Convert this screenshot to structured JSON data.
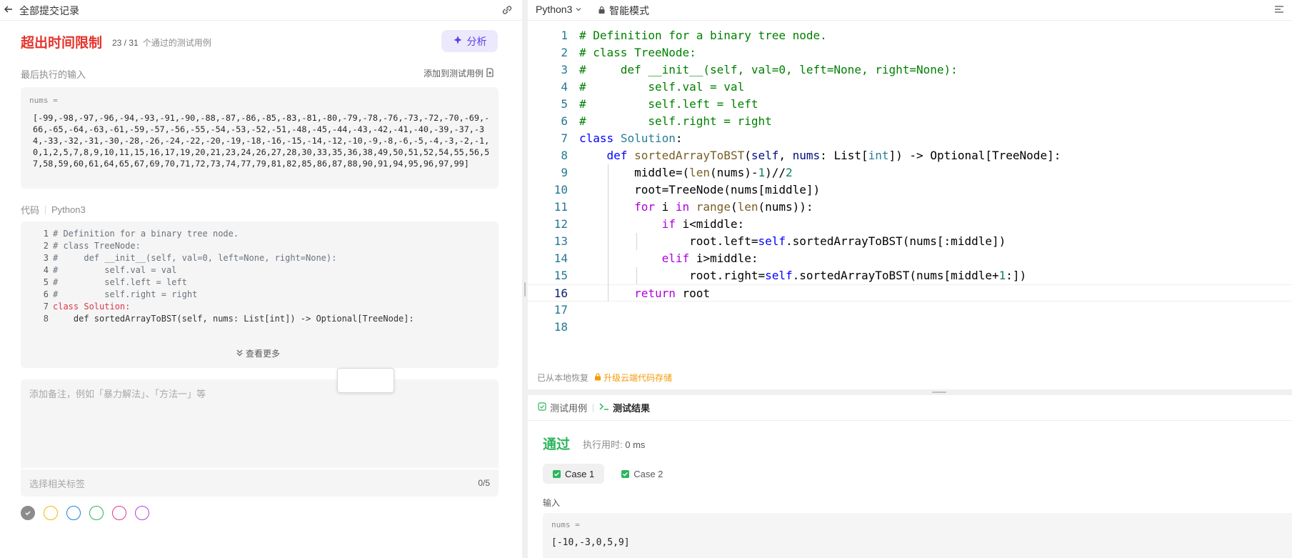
{
  "left": {
    "back_label": "全部提交记录",
    "status_title": "超出时间限制",
    "test_passed": "23 / 31",
    "test_passed_suffix": "个通过的测试用例",
    "analyze_label": "分析",
    "last_input_label": "最后执行的输入",
    "add_testcase_label": "添加到测试用例",
    "input_var": "nums =",
    "input_value": "[-99,-98,-97,-96,-94,-93,-91,-90,-88,-87,-86,-85,-83,-81,-80,-79,-78,-76,-73,-72,-70,-69,-66,-65,-64,-63,-61,-59,-57,-56,-55,-54,-53,-52,-51,-48,-45,-44,-43,-42,-41,-40,-39,-37,-34,-33,-32,-31,-30,-28,-26,-24,-22,-20,-19,-18,-16,-15,-14,-12,-10,-9,-8,-6,-5,-4,-3,-2,-1,0,1,2,5,7,8,9,10,11,15,16,17,19,20,21,23,24,26,27,28,30,33,35,36,38,49,50,51,52,54,55,56,57,58,59,60,61,64,65,67,69,70,71,72,73,74,77,79,81,82,85,86,87,88,90,91,94,95,96,97,99]",
    "code_label": "代码",
    "code_lang": "Python3",
    "code_lines": [
      {
        "n": "1",
        "t": "# Definition for a binary tree node."
      },
      {
        "n": "2",
        "t": "# class TreeNode:"
      },
      {
        "n": "3",
        "t": "#     def __init__(self, val=0, left=None, right=None):"
      },
      {
        "n": "4",
        "t": "#         self.val = val"
      },
      {
        "n": "5",
        "t": "#         self.left = left"
      },
      {
        "n": "6",
        "t": "#         self.right = right"
      },
      {
        "n": "7",
        "t": "class Solution:"
      },
      {
        "n": "8",
        "t": "    def sortedArrayToBST(self, nums: List[int]) -> Optional[TreeNode]:"
      }
    ],
    "view_more_label": "查看更多",
    "note_placeholder": "添加备注，例如「暴力解法」、「方法一」等",
    "tag_placeholder": "选择相关标签",
    "tag_count": "0/5",
    "colors": [
      "#8c8c8c",
      "#f5b800",
      "#1e7fe0",
      "#2db55d",
      "#e0388d",
      "#b43fe0"
    ]
  },
  "editor": {
    "lang": "Python3",
    "mode": "智能模式",
    "line_numbers": [
      "1",
      "2",
      "3",
      "4",
      "5",
      "6",
      "7",
      "8",
      "9",
      "10",
      "11",
      "12",
      "13",
      "14",
      "15",
      "16",
      "17",
      "18"
    ],
    "status_restored": "已从本地恢复",
    "status_upgrade": "升级云端代码存储"
  },
  "result": {
    "tab_testcase": "测试用例",
    "tab_result": "测试结果",
    "pass_title": "通过",
    "runtime_label": "执行用时:",
    "runtime_value": "0 ms",
    "case1": "Case 1",
    "case2": "Case 2",
    "input_label": "输入",
    "input_var": "nums =",
    "input_value": "[-10,-3,0,5,9]"
  },
  "colors": {
    "error": "#e5342c",
    "success": "#2db55d",
    "accent": "#5c3ee6",
    "warning": "#f59a0a"
  }
}
